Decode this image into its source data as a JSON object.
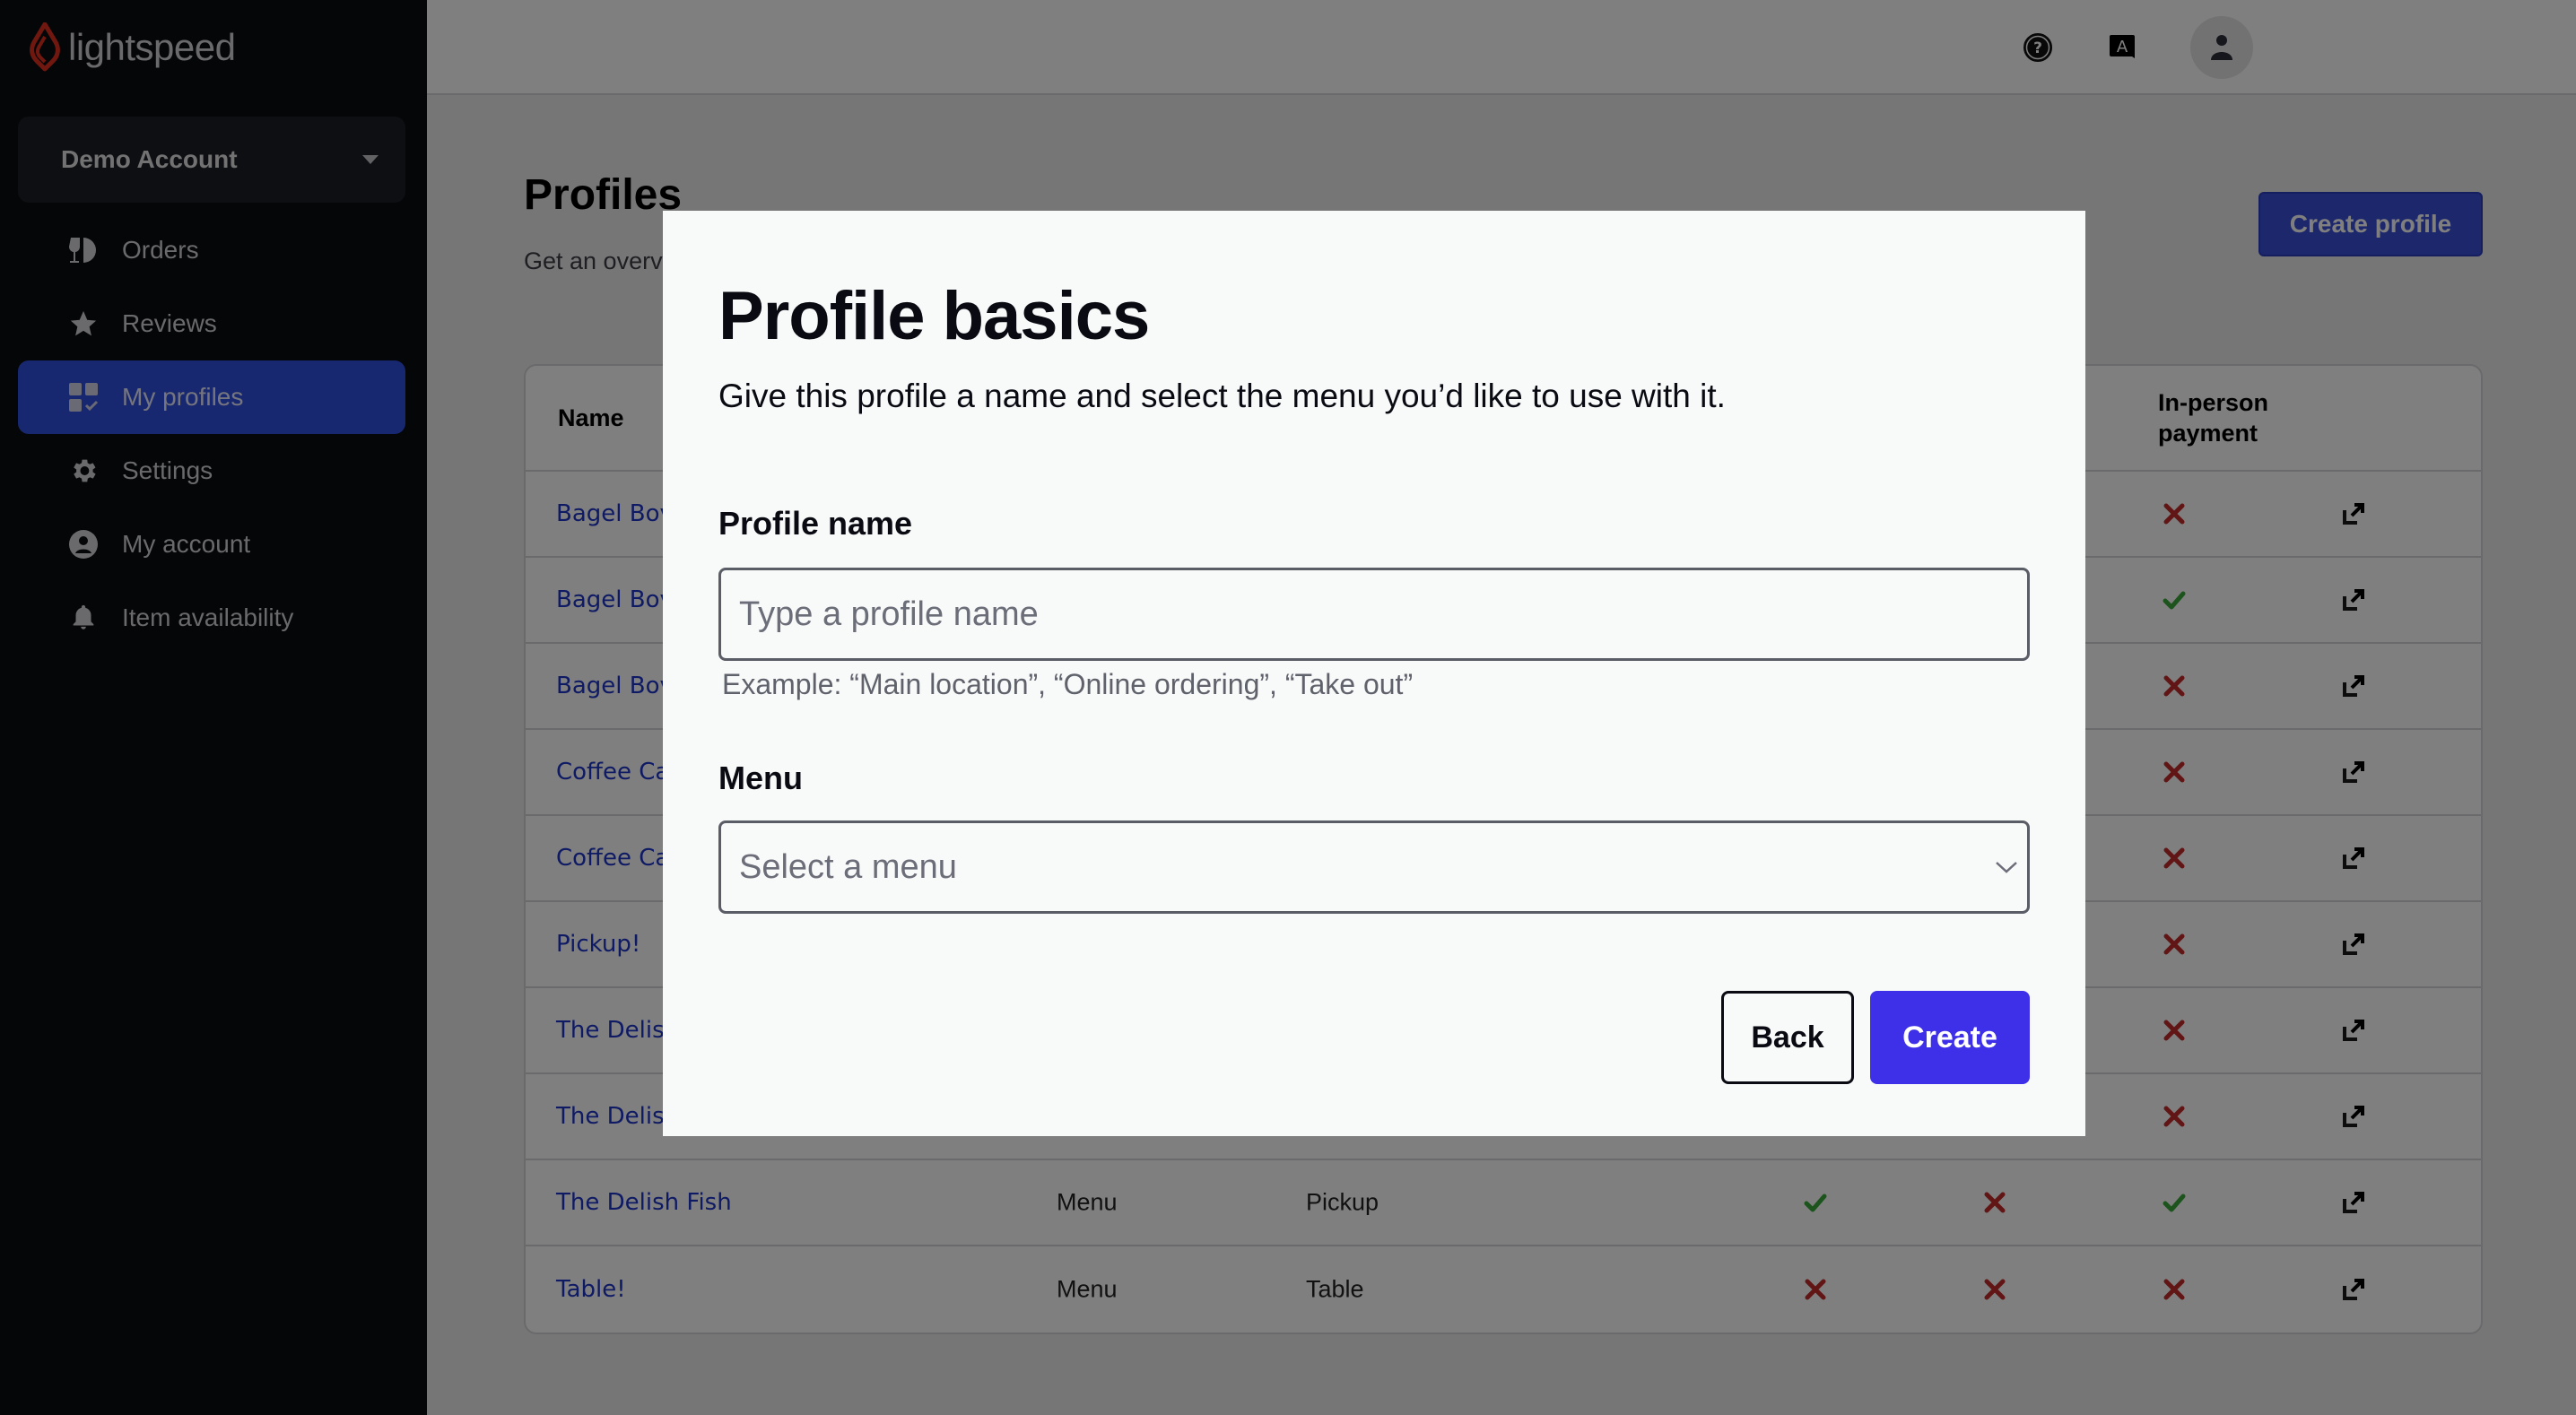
{
  "brand": {
    "name": "lightspeed",
    "accent_color": "#e0301e"
  },
  "sidebar": {
    "account_switcher": {
      "label": "Demo Account",
      "icon": "caret-down-icon"
    },
    "items": [
      {
        "label": "Orders",
        "icon": "orders-icon",
        "active": false
      },
      {
        "label": "Reviews",
        "icon": "star-icon",
        "active": false
      },
      {
        "label": "My profiles",
        "icon": "profiles-grid-icon",
        "active": true
      },
      {
        "label": "Settings",
        "icon": "gear-icon",
        "active": false
      },
      {
        "label": "My account",
        "icon": "user-circle-icon",
        "active": false
      },
      {
        "label": "Item availability",
        "icon": "bell-icon",
        "active": false
      }
    ]
  },
  "topbar": {
    "icons": [
      "help-icon",
      "language-icon",
      "user-avatar-icon"
    ]
  },
  "page": {
    "title": "Profiles",
    "subtitle": "Get an overv",
    "create_button": "Create profile"
  },
  "table": {
    "headers": {
      "name": "Name",
      "in_person_payment_line1": "In-person",
      "in_person_payment_line2": "payment"
    },
    "rows": [
      {
        "name": "Bagel Bov",
        "type": "",
        "mode": "",
        "a": null,
        "b": null,
        "c": false
      },
      {
        "name": "Bagel Bov",
        "type": "",
        "mode": "",
        "a": null,
        "b": null,
        "c": true
      },
      {
        "name": "Bagel Bov",
        "type": "",
        "mode": "",
        "a": null,
        "b": null,
        "c": false
      },
      {
        "name": "Coffee Ca",
        "type": "",
        "mode": "",
        "a": null,
        "b": null,
        "c": false
      },
      {
        "name": "Coffee Ca",
        "type": "",
        "mode": "",
        "a": null,
        "b": null,
        "c": false
      },
      {
        "name": "Pickup!",
        "type": "",
        "mode": "",
        "a": null,
        "b": null,
        "c": false
      },
      {
        "name": "The Delis",
        "type": "",
        "mode": "",
        "a": null,
        "b": null,
        "c": false
      },
      {
        "name": "The Delis",
        "type": "",
        "mode": "",
        "a": null,
        "b": null,
        "c": false
      },
      {
        "name": "The Delish Fish",
        "type": "Menu",
        "mode": "Pickup",
        "a": true,
        "b": false,
        "c": true
      },
      {
        "name": "Table!",
        "type": "Menu",
        "mode": "Table",
        "a": false,
        "b": false,
        "c": false
      }
    ],
    "colors": {
      "yes": "#3aa83a",
      "no": "#c42a2a"
    }
  },
  "modal": {
    "title": "Profile basics",
    "description": "Give this profile a name and select the menu you’d like to use with it.",
    "profile_name": {
      "label": "Profile name",
      "value": "",
      "placeholder": "Type a profile name",
      "helper": "Example: “Main location”, “Online ordering”, “Take out”"
    },
    "menu": {
      "label": "Menu",
      "selected": "Select a menu"
    },
    "back_button": "Back",
    "create_button": "Create",
    "primary_color": "#3d30e8"
  }
}
